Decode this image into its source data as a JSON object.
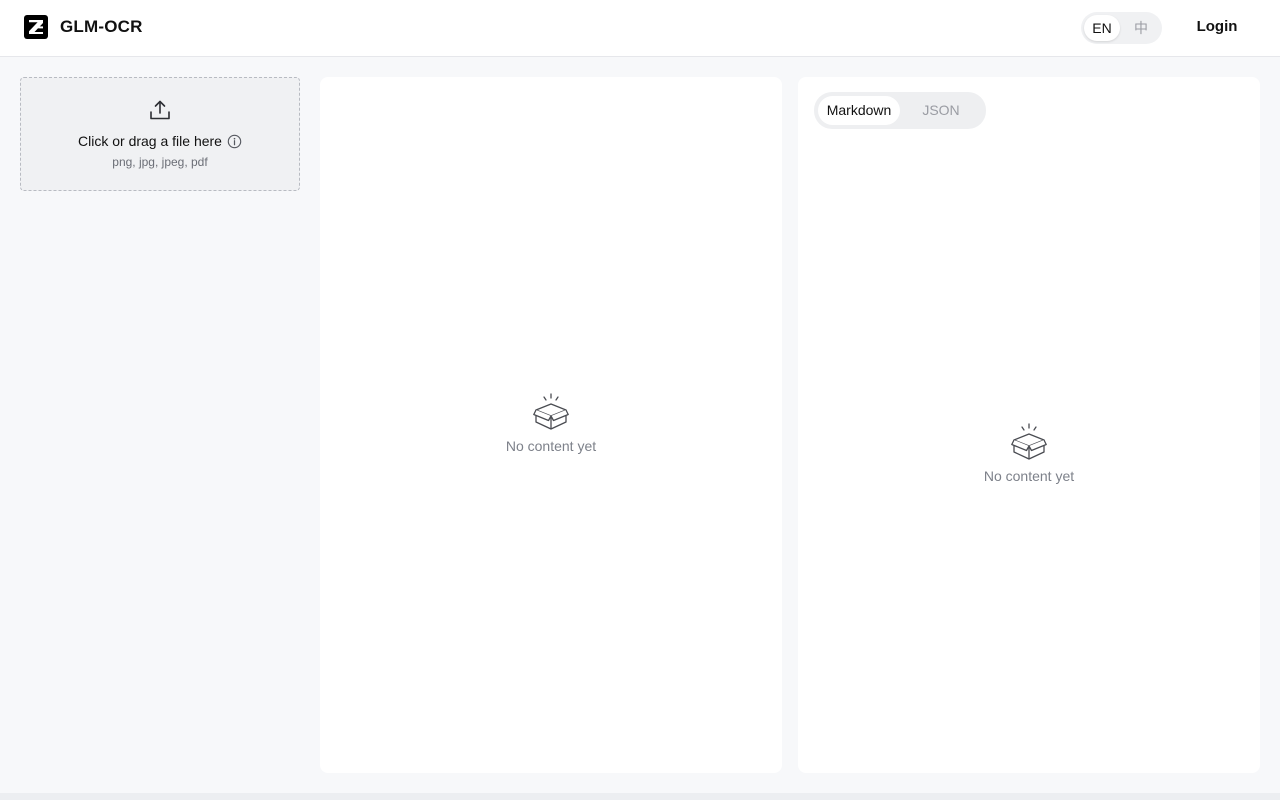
{
  "header": {
    "brand": "GLM-OCR",
    "logo_icon": "z-logo-icon",
    "lang": {
      "en": "EN",
      "zh": "中",
      "active": "EN"
    },
    "login_label": "Login"
  },
  "upload": {
    "icon": "upload-icon",
    "title": "Click or drag a file here",
    "info_icon": "info-icon",
    "hint": "png, jpg, jpeg, pdf"
  },
  "preview_panel": {
    "empty_icon": "empty-box-icon",
    "empty_text": "No content yet"
  },
  "result_panel": {
    "tabs": [
      {
        "label": "Markdown",
        "active": true
      },
      {
        "label": "JSON",
        "active": false
      }
    ],
    "empty_icon": "empty-box-icon",
    "empty_text": "No content yet"
  },
  "colors": {
    "background": "#f7f8fa",
    "panel": "#ffffff",
    "muted_text": "#7d818a",
    "inactive_tab": "#9a9ca3"
  }
}
